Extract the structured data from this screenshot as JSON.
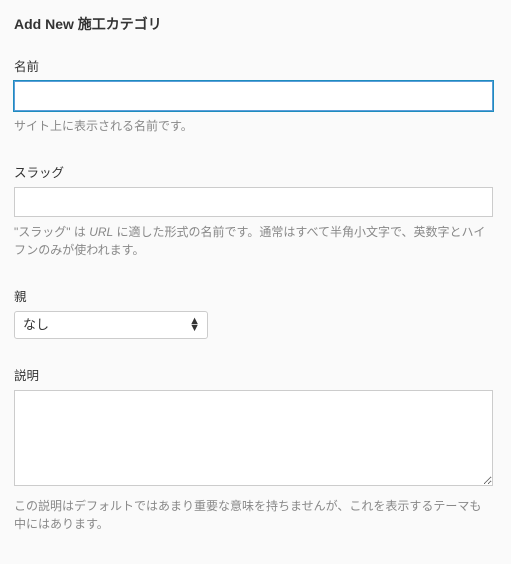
{
  "page": {
    "title": "Add New 施工カテゴリ"
  },
  "fields": {
    "name": {
      "label": "名前",
      "value": "",
      "help": "サイト上に表示される名前です。"
    },
    "slug": {
      "label": "スラッグ",
      "value": "",
      "help_pre": "\"スラッグ\" は ",
      "help_em": "URL",
      "help_post": " に適した形式の名前です。通常はすべて半角小文字で、英数字とハイフンのみが使われます。"
    },
    "parent": {
      "label": "親",
      "selected": "なし"
    },
    "description": {
      "label": "説明",
      "value": "",
      "help": "この説明はデフォルトではあまり重要な意味を持ちませんが、これを表示するテーマも中にはあります。"
    }
  }
}
